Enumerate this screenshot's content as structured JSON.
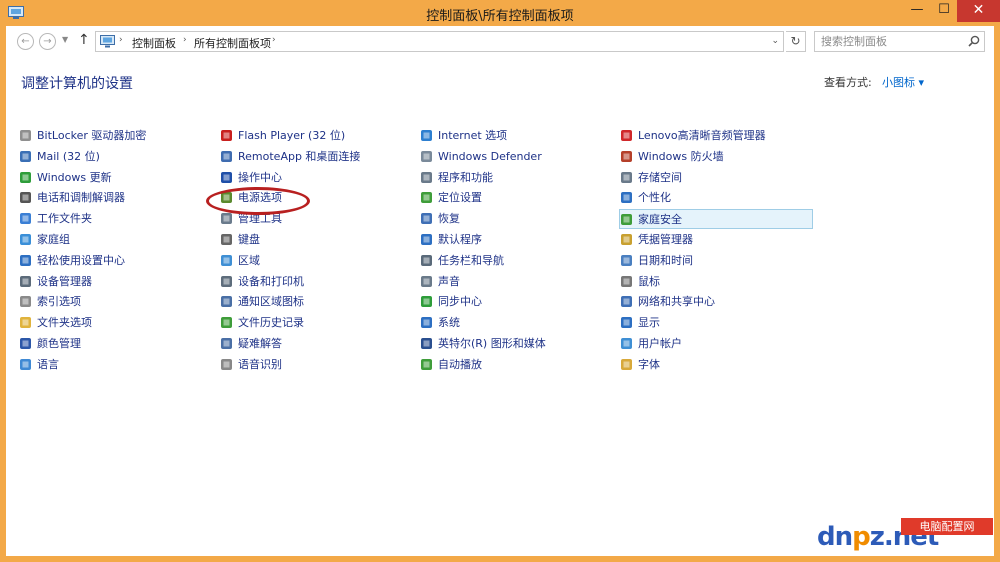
{
  "titlebar": {
    "title": "控制面板\\所有控制面板项",
    "minimize": "—",
    "maximize": "☐",
    "close": "✕"
  },
  "addressbar": {
    "back": "←",
    "forward": "→",
    "recent": "▼",
    "up": "↑",
    "separator": "›",
    "breadcrumb": [
      "控制面板",
      "所有控制面板项"
    ],
    "dropdown": "⌄",
    "refresh": "↻",
    "search_placeholder": "搜索控制面板"
  },
  "header": {
    "title": "调整计算机的设置",
    "view_by_label": "查看方式:",
    "view_by_value": "小图标 ▾"
  },
  "items": [
    [
      {
        "label": "BitLocker 驱动器加密",
        "icon": "bitlocker-icon",
        "color": "#8f8f8f"
      },
      {
        "label": "Mail (32 位)",
        "icon": "mail-icon",
        "color": "#3a6fb5"
      },
      {
        "label": "Windows 更新",
        "icon": "windows-update-icon",
        "color": "#2e9d3a"
      },
      {
        "label": "电话和调制解调器",
        "icon": "phone-modem-icon",
        "color": "#555555"
      },
      {
        "label": "工作文件夹",
        "icon": "work-folders-icon",
        "color": "#3a7fd5"
      },
      {
        "label": "家庭组",
        "icon": "homegroup-icon",
        "color": "#3a8fd8"
      },
      {
        "label": "轻松使用设置中心",
        "icon": "ease-of-access-icon",
        "color": "#2d6fc2"
      },
      {
        "label": "设备管理器",
        "icon": "device-manager-icon",
        "color": "#5c6b7a"
      },
      {
        "label": "索引选项",
        "icon": "indexing-icon",
        "color": "#8a8a8a"
      },
      {
        "label": "文件夹选项",
        "icon": "folder-options-icon",
        "color": "#e0b33c"
      },
      {
        "label": "颜色管理",
        "icon": "color-management-icon",
        "color": "#2c57a8"
      },
      {
        "label": "语言",
        "icon": "language-icon",
        "color": "#3f89d4"
      }
    ],
    [
      {
        "label": "Flash Player (32 位)",
        "icon": "flash-player-icon",
        "color": "#c8201e"
      },
      {
        "label": "RemoteApp 和桌面连接",
        "icon": "remoteapp-icon",
        "color": "#3f6cb0"
      },
      {
        "label": "操作中心",
        "icon": "action-center-icon",
        "color": "#1f4fa8"
      },
      {
        "label": "电源选项",
        "icon": "power-options-icon",
        "color": "#5a8a2e"
      },
      {
        "label": "管理工具",
        "icon": "admin-tools-icon",
        "color": "#6a7b8c"
      },
      {
        "label": "键盘",
        "icon": "keyboard-icon",
        "color": "#666666"
      },
      {
        "label": "区域",
        "icon": "region-icon",
        "color": "#3f8fd4"
      },
      {
        "label": "设备和打印机",
        "icon": "devices-printers-icon",
        "color": "#5e6d7c"
      },
      {
        "label": "通知区域图标",
        "icon": "notification-icons-icon",
        "color": "#4a6fa5"
      },
      {
        "label": "文件历史记录",
        "icon": "file-history-icon",
        "color": "#3f9d3a"
      },
      {
        "label": "疑难解答",
        "icon": "troubleshooting-icon",
        "color": "#4a6fa5"
      },
      {
        "label": "语音识别",
        "icon": "speech-recognition-icon",
        "color": "#888888"
      }
    ],
    [
      {
        "label": "Internet 选项",
        "icon": "internet-options-icon",
        "color": "#2d7fd0"
      },
      {
        "label": "Windows Defender",
        "icon": "windows-defender-icon",
        "color": "#7a8a9a"
      },
      {
        "label": "程序和功能",
        "icon": "programs-features-icon",
        "color": "#6a7a8a"
      },
      {
        "label": "定位设置",
        "icon": "location-settings-icon",
        "color": "#3f9d3a"
      },
      {
        "label": "恢复",
        "icon": "recovery-icon",
        "color": "#3f6fb5"
      },
      {
        "label": "默认程序",
        "icon": "default-programs-icon",
        "color": "#2d6fc2"
      },
      {
        "label": "任务栏和导航",
        "icon": "taskbar-navigation-icon",
        "color": "#5a6a7a"
      },
      {
        "label": "声音",
        "icon": "sound-icon",
        "color": "#6a7a8a"
      },
      {
        "label": "同步中心",
        "icon": "sync-center-icon",
        "color": "#2e9d3a"
      },
      {
        "label": "系统",
        "icon": "system-icon",
        "color": "#2d6fc2"
      },
      {
        "label": "英特尔(R) 图形和媒体",
        "icon": "intel-graphics-icon",
        "color": "#2a4f8f"
      },
      {
        "label": "自动播放",
        "icon": "autoplay-icon",
        "color": "#3f9d3a"
      }
    ],
    [
      {
        "label": "Lenovo高清晰音频管理器",
        "icon": "lenovo-audio-icon",
        "color": "#d0282a"
      },
      {
        "label": "Windows 防火墙",
        "icon": "firewall-icon",
        "color": "#b5402a"
      },
      {
        "label": "存储空间",
        "icon": "storage-spaces-icon",
        "color": "#6a7a8a"
      },
      {
        "label": "个性化",
        "icon": "personalization-icon",
        "color": "#2d6fc2"
      },
      {
        "label": "家庭安全",
        "icon": "family-safety-icon",
        "color": "#3f9d3a",
        "selected": true
      },
      {
        "label": "凭据管理器",
        "icon": "credential-manager-icon",
        "color": "#c8a030"
      },
      {
        "label": "日期和时间",
        "icon": "date-time-icon",
        "color": "#4a7fc0"
      },
      {
        "label": "鼠标",
        "icon": "mouse-icon",
        "color": "#777777"
      },
      {
        "label": "网络和共享中心",
        "icon": "network-sharing-icon",
        "color": "#3f6fb5"
      },
      {
        "label": "显示",
        "icon": "display-icon",
        "color": "#2d6fc2"
      },
      {
        "label": "用户帐户",
        "icon": "user-accounts-icon",
        "color": "#3f8fd4"
      },
      {
        "label": "字体",
        "icon": "fonts-icon",
        "color": "#d8a93a"
      }
    ]
  ],
  "watermark": {
    "brand_main": "dn",
    "brand_accent": "p",
    "brand_tail": "z.net",
    "tag": "电脑配置网"
  },
  "colors": {
    "accent_title": "#f3a948",
    "link": "#1e3287",
    "highlight": "#b82020",
    "close": "#c7372f"
  }
}
